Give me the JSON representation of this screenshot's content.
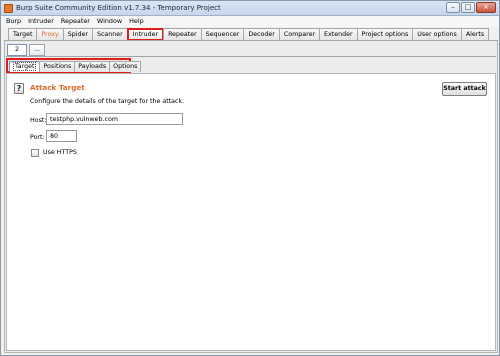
{
  "window": {
    "title": "Burp Suite Community Edition v1.7.34 - Temporary Project",
    "minimize": "–",
    "maximize": "□",
    "close": "×"
  },
  "menu": [
    "Burp",
    "Intruder",
    "Repeater",
    "Window",
    "Help"
  ],
  "main_tabs": [
    {
      "label": "Target"
    },
    {
      "label": "Proxy"
    },
    {
      "label": "Spider"
    },
    {
      "label": "Scanner"
    },
    {
      "label": "Intruder"
    },
    {
      "label": "Repeater"
    },
    {
      "label": "Sequencer"
    },
    {
      "label": "Decoder"
    },
    {
      "label": "Comparer"
    },
    {
      "label": "Extender"
    },
    {
      "label": "Project options"
    },
    {
      "label": "User options"
    },
    {
      "label": "Alerts"
    }
  ],
  "instance_tabs": [
    {
      "label": "2"
    },
    {
      "label": "..."
    }
  ],
  "sub_tabs": [
    {
      "label": "Target"
    },
    {
      "label": "Positions"
    },
    {
      "label": "Payloads"
    },
    {
      "label": "Options"
    }
  ],
  "attack_target": {
    "title": "Attack Target",
    "description": "Configure the details of the target for the attack.",
    "start_button": "Start attack",
    "host_label": "Host:",
    "host_value": "testphp.vulnweb.com",
    "port_label": "Port:",
    "port_value": "80",
    "https_label": "Use HTTPS",
    "https_checked": false
  },
  "colors": {
    "accent_orange": "#e06a28",
    "highlight_red": "#e01c1c"
  },
  "icons": {
    "app": "burp-logo-icon",
    "help": "help-icon"
  }
}
